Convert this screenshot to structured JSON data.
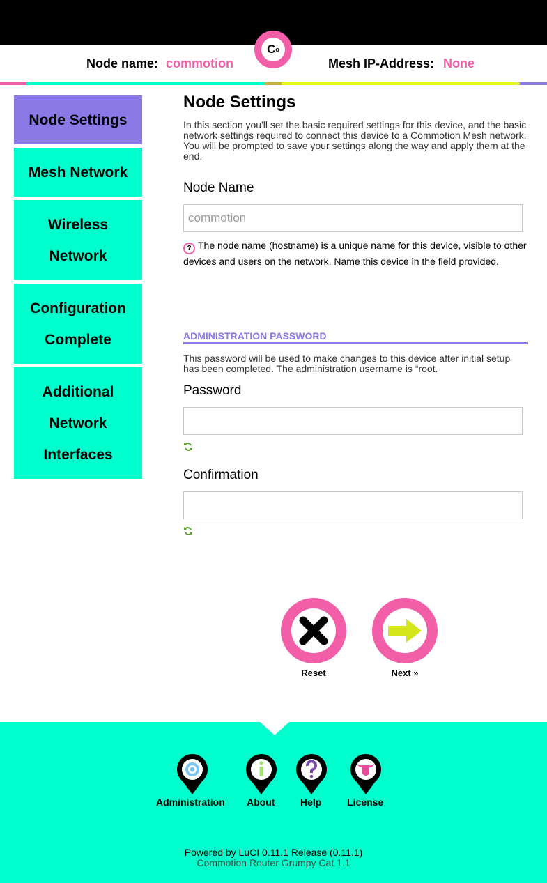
{
  "header": {
    "node_name_label": "Node name:",
    "node_name_value": "commotion",
    "mesh_ip_label": "Mesh IP-Address:",
    "mesh_ip_value": "None",
    "logo_text": "C",
    "logo_sup": "o"
  },
  "colors": {
    "accent_pink": "#f25ea8",
    "accent_teal": "#00ffcc",
    "accent_purple": "#8b7ae6",
    "accent_lime": "#e4f520"
  },
  "sidebar": {
    "items": [
      {
        "label": "Node Settings",
        "active": true
      },
      {
        "label": "Mesh Network",
        "active": false
      },
      {
        "label": "Wireless Network",
        "active": false
      },
      {
        "label": "Configuration Complete",
        "active": false
      },
      {
        "label": "Additional Network Interfaces",
        "active": false
      }
    ]
  },
  "main": {
    "title": "Node Settings",
    "intro": "In this section you'll set the basic required settings for this device, and the basic network settings required to connect this device to a Commotion Mesh network. You will be prompted to save your settings along the way and apply them at the end.",
    "node_name": {
      "label": "Node Name",
      "placeholder": "commotion",
      "value": "",
      "help_icon": "question-icon",
      "help": "The node name (hostname) is a unique name for this device, visible to other devices and users on the network. Name this device in the field provided."
    },
    "admin_section": {
      "heading": "ADMINISTRATION PASSWORD",
      "description": "This password will be used to make changes to this device after initial setup has been completed. The administration username is “root."
    },
    "password": {
      "label": "Password",
      "value": "",
      "icon": "refresh-icon"
    },
    "confirmation": {
      "label": "Confirmation",
      "value": "",
      "icon": "refresh-icon"
    }
  },
  "actions": {
    "reset_label": "Reset",
    "reset_icon": "close-x-icon",
    "next_label": "Next »",
    "next_icon": "arrow-right-icon"
  },
  "footer": {
    "links": [
      {
        "label": "Administration",
        "icon": "target-icon"
      },
      {
        "label": "About",
        "icon": "info-icon"
      },
      {
        "label": "Help",
        "icon": "question-icon"
      },
      {
        "label": "License",
        "icon": "bull-icon"
      }
    ],
    "powered_by": "Powered by LuCI 0.11.1 Release (0.11.1)",
    "release": "Commotion Router Grumpy Cat 1.1"
  }
}
